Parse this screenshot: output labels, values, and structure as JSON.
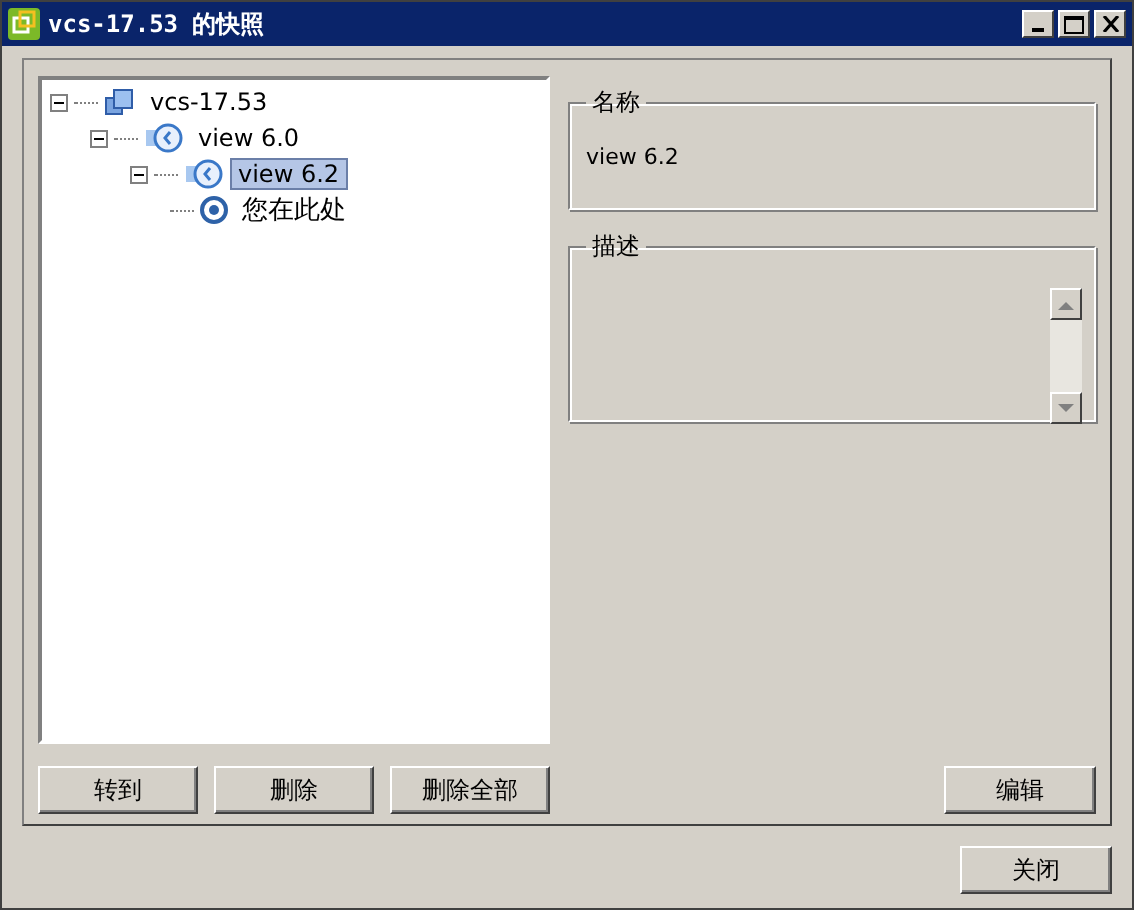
{
  "window": {
    "title": "vcs-17.53 的快照"
  },
  "tree": [
    {
      "label": "vcs-17.53",
      "kind": "host",
      "expanded": true,
      "selected": false,
      "children": [
        {
          "label": "view 6.0",
          "kind": "snapshot",
          "expanded": true,
          "selected": false,
          "children": [
            {
              "label": "view 6.2",
              "kind": "snapshot",
              "expanded": true,
              "selected": true,
              "children": [
                {
                  "label": "您在此处",
                  "kind": "current",
                  "selected": false
                }
              ]
            }
          ]
        }
      ]
    }
  ],
  "name_group": {
    "title": "名称",
    "value": "view 6.2"
  },
  "description_group": {
    "title": "描述"
  },
  "tree_buttons": [
    "转到",
    "删除",
    "删除全部"
  ],
  "edit_button": "编辑",
  "close_button": "关闭"
}
